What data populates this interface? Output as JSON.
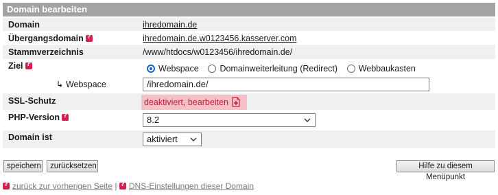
{
  "header": {
    "title": "Domain bearbeiten"
  },
  "rows": {
    "domain": {
      "label": "Domain",
      "value": "ihredomain.de"
    },
    "uebergang": {
      "label": "Übergangsdomain",
      "value": "ihredomain.de.w0123456.kasserver.com"
    },
    "stamm": {
      "label": "Stammverzeichnis",
      "value": "/www/htdocs/w0123456/ihredomain.de/"
    },
    "ziel": {
      "label": "Ziel",
      "options": [
        "Webspace",
        "Domainweiterleitung (Redirect)",
        "Webbaukasten"
      ],
      "selected": "Webspace"
    },
    "webspace": {
      "label": "↳ Webspace",
      "value": "/ihredomain.de/"
    },
    "ssl": {
      "label": "SSL-Schutz",
      "value": "deaktiviert, bearbeiten"
    },
    "php": {
      "label": "PHP-Version",
      "value": "8.2"
    },
    "domain_ist": {
      "label": "Domain ist",
      "value": "aktiviert"
    }
  },
  "buttons": {
    "save": "speichern",
    "reset": "zurücksetzen",
    "help": "Hilfe zu diesem Menüpunkt"
  },
  "footer": {
    "back": "zurück zur vorherigen Seite",
    "separator": "|",
    "dns": "DNS-Einstellungen dieser Domain"
  },
  "colors": {
    "header_bg": "#a3a3a3",
    "alt_row_bg": "#f0f0f0",
    "help_icon": "#d6204d",
    "ssl_bg": "#f6c1c6",
    "ssl_text": "#c0203a",
    "radio_accent": "#1a64c8"
  },
  "icons": {
    "help": "help-question-icon",
    "ssl": "document-add-icon",
    "select": "chevron-down-icon"
  }
}
